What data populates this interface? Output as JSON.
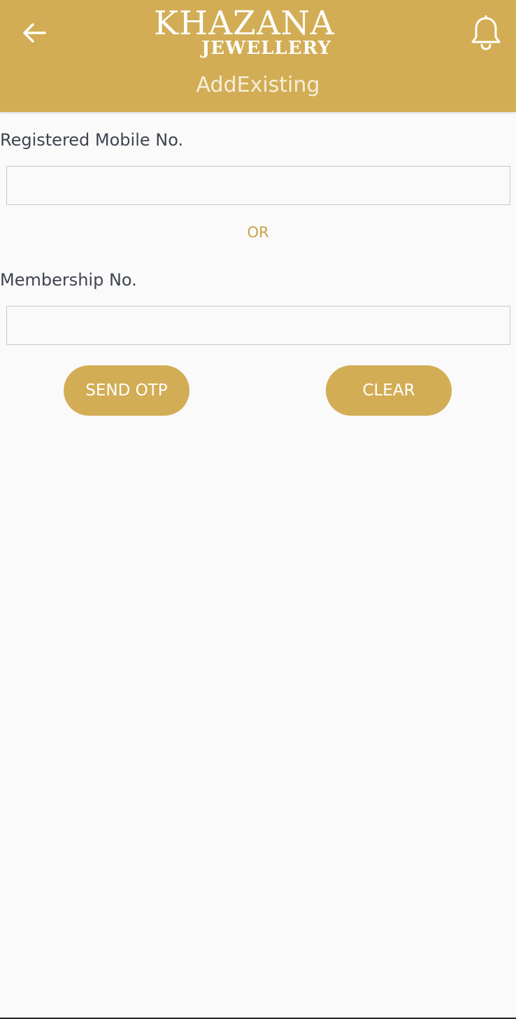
{
  "header": {
    "logo_main": "KHAZANA",
    "logo_sub": "JEWELLERY",
    "title": "AddExisting",
    "back_icon": "arrow-left-icon",
    "bell_icon": "bell-icon",
    "bar_color": "#d2ad55"
  },
  "form": {
    "mobile_label": "Registered Mobile No.",
    "mobile_value": "",
    "separator": "OR",
    "membership_label": "Membership No.",
    "membership_value": ""
  },
  "actions": {
    "send_otp": "SEND OTP",
    "clear": "CLEAR"
  }
}
